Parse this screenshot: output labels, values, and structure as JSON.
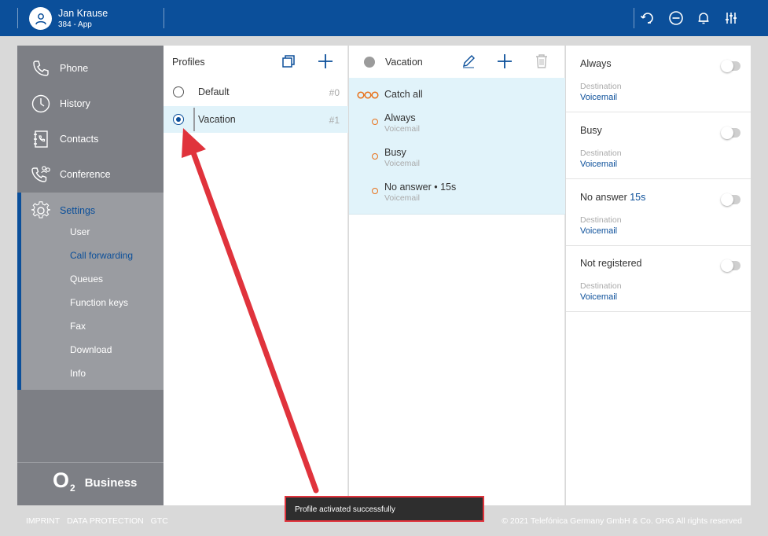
{
  "header": {
    "user_name": "Jan Krause",
    "user_sub": "384 - App",
    "icons": [
      "redirect-icon",
      "dnd-icon",
      "bell-icon",
      "equalizer-icon"
    ]
  },
  "sidebar": {
    "items": [
      {
        "label": "Phone",
        "icon": "phone-icon"
      },
      {
        "label": "History",
        "icon": "clock-icon"
      },
      {
        "label": "Contacts",
        "icon": "contacts-icon"
      },
      {
        "label": "Conference",
        "icon": "conference-icon"
      },
      {
        "label": "Settings",
        "icon": "gear-icon"
      }
    ],
    "settings_sub": [
      "User",
      "Call forwarding",
      "Queues",
      "Function keys",
      "Fax",
      "Download",
      "Info"
    ],
    "active_sub": "Call forwarding",
    "brand": {
      "o2": "O",
      "two": "2",
      "business": "Business"
    }
  },
  "profiles": {
    "title": "Profiles",
    "items": [
      {
        "name": "Default",
        "index": "#0",
        "selected": false
      },
      {
        "name": "Vacation",
        "index": "#1",
        "selected": true
      }
    ]
  },
  "rules": {
    "title": "Vacation",
    "catch_all": "Catch all",
    "items": [
      {
        "name": "Always",
        "sub": "Voicemail"
      },
      {
        "name": "Busy",
        "sub": "Voicemail"
      },
      {
        "name": "No answer • 15s",
        "sub": "Voicemail"
      }
    ]
  },
  "detail": {
    "sections": [
      {
        "title": "Always",
        "highlight": "",
        "dest_label": "Destination",
        "dest_value": "Voicemail"
      },
      {
        "title": "Busy",
        "highlight": "",
        "dest_label": "Destination",
        "dest_value": "Voicemail"
      },
      {
        "title": "No answer",
        "highlight": "15s",
        "dest_label": "Destination",
        "dest_value": "Voicemail"
      },
      {
        "title": "Not registered",
        "highlight": "",
        "dest_label": "Destination",
        "dest_value": "Voicemail"
      }
    ]
  },
  "footer": {
    "links": [
      "IMPRINT",
      "DATA PROTECTION",
      "GTC"
    ],
    "copyright": "© 2021 Telefónica Germany GmbH & Co. OHG All rights reserved"
  },
  "toast": {
    "message": "Profile activated successfully"
  },
  "colors": {
    "brand_blue": "#0b4f9a",
    "accent_orange": "#e8711a",
    "selection": "#e1f3fa",
    "annotation_red": "#e0333c"
  }
}
